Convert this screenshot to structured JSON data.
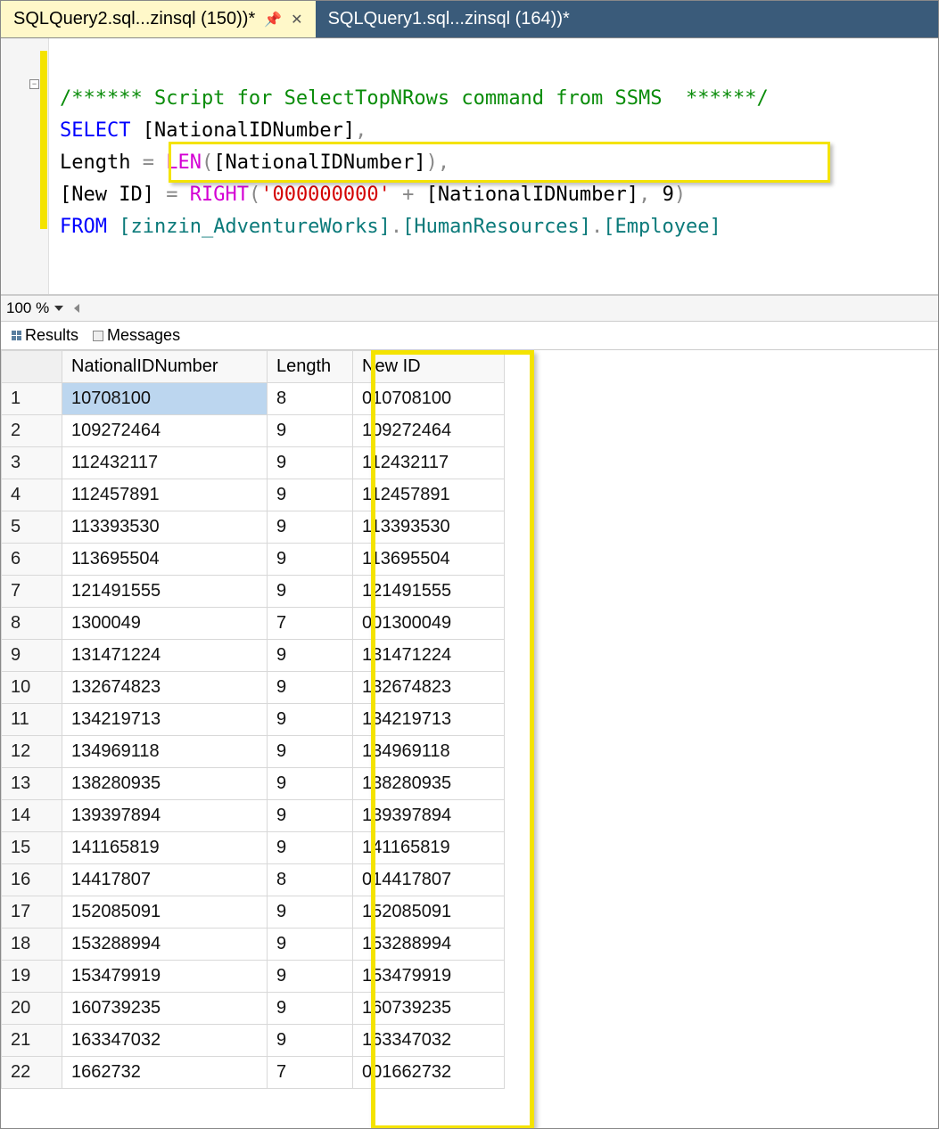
{
  "tabs": [
    {
      "label": "SQLQuery2.sql...zinsql (150))*",
      "active": true
    },
    {
      "label": "SQLQuery1.sql...zinsql (164))*",
      "active": false
    }
  ],
  "code": {
    "comment": "/****** Script for SelectTopNRows command from SSMS  ******/",
    "select_kw": "SELECT",
    "col1": " [NationalIDNumber]",
    "length_label": "Length",
    "len_func": "LEN",
    "len_arg": "[NationalIDNumber]",
    "newid_label": "[New ID]",
    "right_func": "RIGHT",
    "zeros": "'000000000'",
    "plus": " + ",
    "right_arg": "[NationalIDNumber]",
    "nine": " 9",
    "from_kw": "FROM",
    "schema1": " [zinzin_AdventureWorks]",
    "schema2": "[HumanResources]",
    "schema3": "[Employee]"
  },
  "zoom": "100 %",
  "panel_tabs": {
    "results": "Results",
    "messages": "Messages"
  },
  "headers": {
    "nid": "NationalIDNumber",
    "len": "Length",
    "newid": "New ID"
  },
  "rows": [
    {
      "n": "1",
      "nid": "10708100",
      "len": "8",
      "new": "010708100"
    },
    {
      "n": "2",
      "nid": "109272464",
      "len": "9",
      "new": "109272464"
    },
    {
      "n": "3",
      "nid": "112432117",
      "len": "9",
      "new": "112432117"
    },
    {
      "n": "4",
      "nid": "112457891",
      "len": "9",
      "new": "112457891"
    },
    {
      "n": "5",
      "nid": "113393530",
      "len": "9",
      "new": "113393530"
    },
    {
      "n": "6",
      "nid": "113695504",
      "len": "9",
      "new": "113695504"
    },
    {
      "n": "7",
      "nid": "121491555",
      "len": "9",
      "new": "121491555"
    },
    {
      "n": "8",
      "nid": "1300049",
      "len": "7",
      "new": "001300049"
    },
    {
      "n": "9",
      "nid": "131471224",
      "len": "9",
      "new": "131471224"
    },
    {
      "n": "10",
      "nid": "132674823",
      "len": "9",
      "new": "132674823"
    },
    {
      "n": "11",
      "nid": "134219713",
      "len": "9",
      "new": "134219713"
    },
    {
      "n": "12",
      "nid": "134969118",
      "len": "9",
      "new": "134969118"
    },
    {
      "n": "13",
      "nid": "138280935",
      "len": "9",
      "new": "138280935"
    },
    {
      "n": "14",
      "nid": "139397894",
      "len": "9",
      "new": "139397894"
    },
    {
      "n": "15",
      "nid": "141165819",
      "len": "9",
      "new": "141165819"
    },
    {
      "n": "16",
      "nid": "14417807",
      "len": "8",
      "new": "014417807"
    },
    {
      "n": "17",
      "nid": "152085091",
      "len": "9",
      "new": "152085091"
    },
    {
      "n": "18",
      "nid": "153288994",
      "len": "9",
      "new": "153288994"
    },
    {
      "n": "19",
      "nid": "153479919",
      "len": "9",
      "new": "153479919"
    },
    {
      "n": "20",
      "nid": "160739235",
      "len": "9",
      "new": "160739235"
    },
    {
      "n": "21",
      "nid": "163347032",
      "len": "9",
      "new": "163347032"
    },
    {
      "n": "22",
      "nid": "1662732",
      "len": "7",
      "new": "001662732"
    }
  ]
}
